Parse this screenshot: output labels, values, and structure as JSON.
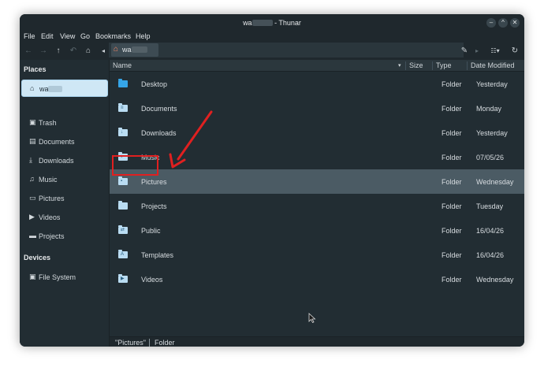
{
  "window": {
    "title_prefix": "wa",
    "title_suffix": " - Thunar",
    "controls": {
      "minimize": "–",
      "maximize": "^",
      "close": "✕"
    }
  },
  "menubar": {
    "items": [
      "File",
      "Edit",
      "View",
      "Go",
      "Bookmarks",
      "Help"
    ]
  },
  "toolbar": {
    "icons": [
      "arrow-left-icon",
      "arrow-right-icon",
      "arrow-up-icon",
      "undo-icon",
      "home-icon",
      "chevron-left-icon",
      "edit-pencil-icon",
      "chevron-right-icon",
      "view-list-icon",
      "reload-icon"
    ],
    "path_crumb": "wa"
  },
  "sidebar": {
    "places_title": "Places",
    "places": [
      {
        "label": "wa",
        "icon": "home-icon",
        "active": true
      },
      {
        "label": "Trash",
        "icon": "trash-icon"
      },
      {
        "label": "Documents",
        "icon": "document-icon"
      },
      {
        "label": "Downloads",
        "icon": "download-icon"
      },
      {
        "label": "Music",
        "icon": "music-icon"
      },
      {
        "label": "Pictures",
        "icon": "picture-icon"
      },
      {
        "label": "Videos",
        "icon": "video-icon"
      },
      {
        "label": "Projects",
        "icon": "folder-icon"
      }
    ],
    "devices_title": "Devices",
    "devices": [
      {
        "label": "File System",
        "icon": "drive-icon"
      }
    ]
  },
  "columns": {
    "name": "Name",
    "size": "Size",
    "type": "Type",
    "date": "Date Modified"
  },
  "files": [
    {
      "name": "Desktop",
      "type": "Folder",
      "date": "Yesterday"
    },
    {
      "name": "Documents",
      "type": "Folder",
      "date": "Monday"
    },
    {
      "name": "Downloads",
      "type": "Folder",
      "date": "Yesterday"
    },
    {
      "name": "Music",
      "type": "Folder",
      "date": "07/05/26"
    },
    {
      "name": "Pictures",
      "type": "Folder",
      "date": "Wednesday",
      "selected": true
    },
    {
      "name": "Projects",
      "type": "Folder",
      "date": "Tuesday"
    },
    {
      "name": "Public",
      "type": "Folder",
      "date": "16/04/26"
    },
    {
      "name": "Templates",
      "type": "Folder",
      "date": "16/04/26"
    },
    {
      "name": "Videos",
      "type": "Folder",
      "date": "Wednesday"
    }
  ],
  "statusbar": {
    "selection": "\"Pictures\"",
    "kind": "Folder"
  },
  "colors": {
    "selection_row": "#4b5b64",
    "sidebar_active": "#cfe7f5",
    "annotation_red": "#e02020",
    "desktop_folder": "#35a5e8"
  }
}
